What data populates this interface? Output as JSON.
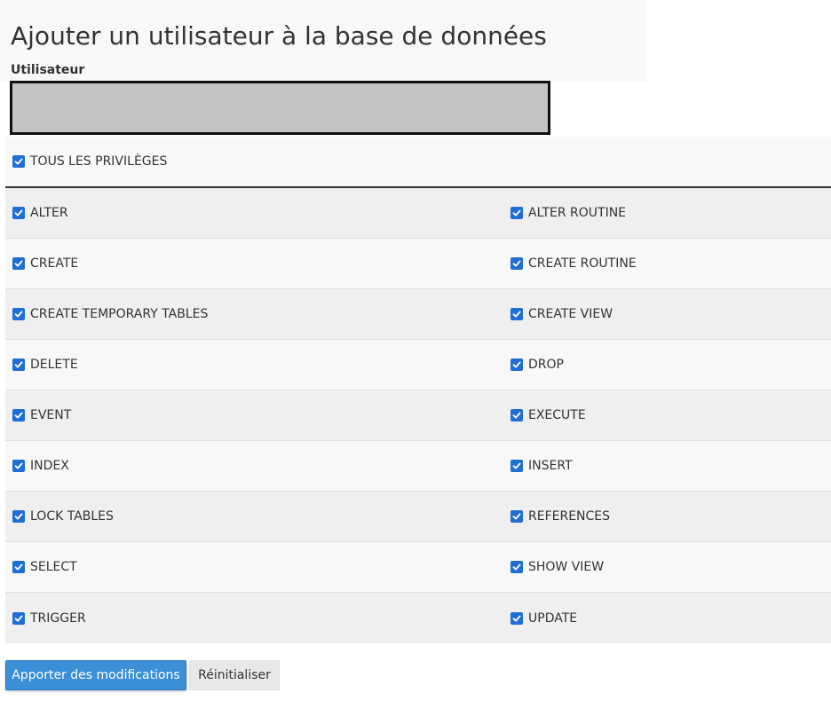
{
  "page": {
    "title": "Ajouter un utilisateur à la base de données",
    "user_label": "Utilisateur",
    "user_value": ""
  },
  "all_privileges": {
    "label": "TOUS LES PRIVILÈGES",
    "checked": true
  },
  "privileges": [
    {
      "left": {
        "label": "ALTER",
        "checked": true
      },
      "right": {
        "label": "ALTER ROUTINE",
        "checked": true
      }
    },
    {
      "left": {
        "label": "CREATE",
        "checked": true
      },
      "right": {
        "label": "CREATE ROUTINE",
        "checked": true
      }
    },
    {
      "left": {
        "label": "CREATE TEMPORARY TABLES",
        "checked": true
      },
      "right": {
        "label": "CREATE VIEW",
        "checked": true
      }
    },
    {
      "left": {
        "label": "DELETE",
        "checked": true
      },
      "right": {
        "label": "DROP",
        "checked": true
      }
    },
    {
      "left": {
        "label": "EVENT",
        "checked": true
      },
      "right": {
        "label": "EXECUTE",
        "checked": true
      }
    },
    {
      "left": {
        "label": "INDEX",
        "checked": true
      },
      "right": {
        "label": "INSERT",
        "checked": true
      }
    },
    {
      "left": {
        "label": "LOCK TABLES",
        "checked": true
      },
      "right": {
        "label": "REFERENCES",
        "checked": true
      }
    },
    {
      "left": {
        "label": "SELECT",
        "checked": true
      },
      "right": {
        "label": "SHOW VIEW",
        "checked": true
      }
    },
    {
      "left": {
        "label": "TRIGGER",
        "checked": true
      },
      "right": {
        "label": "UPDATE",
        "checked": true
      }
    }
  ],
  "buttons": {
    "submit_label": "Apporter des modifications",
    "reset_label": "Réinitialiser"
  },
  "colors": {
    "accent": "#3b8fd6",
    "checkbox": "#1f6ed4"
  }
}
